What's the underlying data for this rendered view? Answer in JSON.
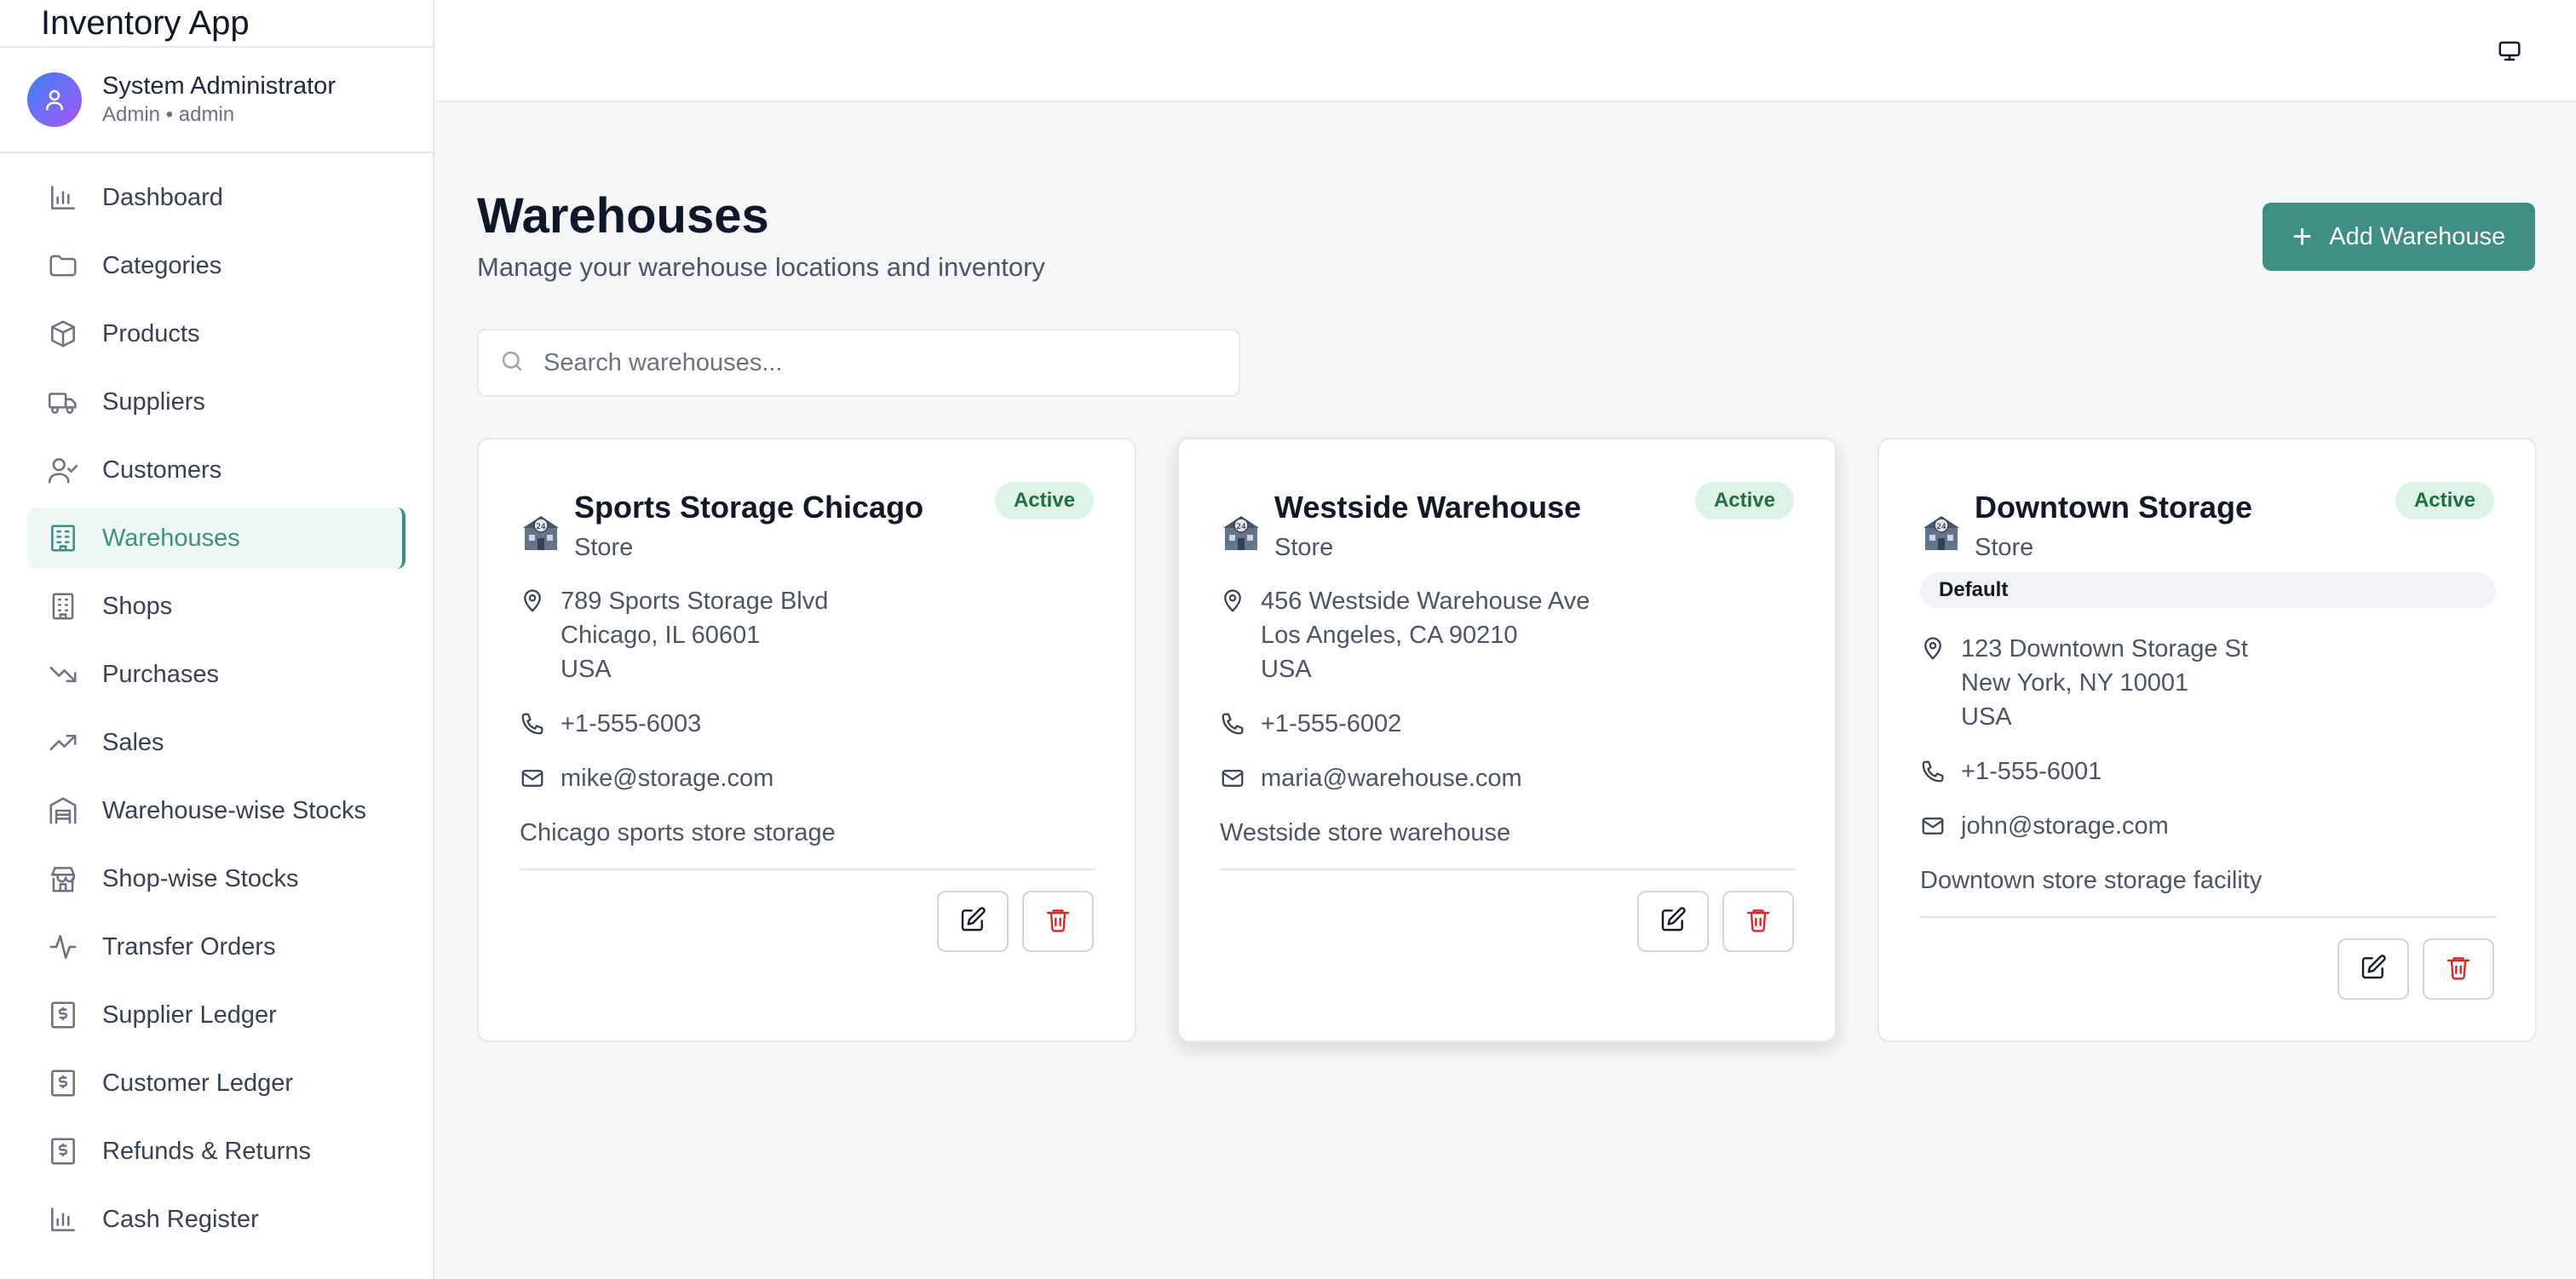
{
  "app": {
    "title": "Inventory App"
  },
  "user": {
    "name": "System Administrator",
    "role_line": "Admin • admin"
  },
  "sidebar": {
    "items": [
      {
        "label": "Dashboard",
        "icon": "bar-chart-icon"
      },
      {
        "label": "Categories",
        "icon": "folder-icon"
      },
      {
        "label": "Products",
        "icon": "box-icon"
      },
      {
        "label": "Suppliers",
        "icon": "truck-icon"
      },
      {
        "label": "Customers",
        "icon": "user-check-icon"
      },
      {
        "label": "Warehouses",
        "icon": "warehouse-building-icon",
        "active": true
      },
      {
        "label": "Shops",
        "icon": "building-icon"
      },
      {
        "label": "Purchases",
        "icon": "trending-down-icon"
      },
      {
        "label": "Sales",
        "icon": "trending-up-icon"
      },
      {
        "label": "Warehouse-wise Stocks",
        "icon": "warehouse-icon"
      },
      {
        "label": "Shop-wise Stocks",
        "icon": "store-icon"
      },
      {
        "label": "Transfer Orders",
        "icon": "activity-icon"
      },
      {
        "label": "Supplier Ledger",
        "icon": "dollar-receipt-icon"
      },
      {
        "label": "Customer Ledger",
        "icon": "dollar-receipt-icon"
      },
      {
        "label": "Refunds & Returns",
        "icon": "dollar-receipt-icon"
      },
      {
        "label": "Cash Register",
        "icon": "bar-chart-icon"
      }
    ]
  },
  "page": {
    "title": "Warehouses",
    "subtitle": "Manage your warehouse locations and inventory",
    "add_button": "Add Warehouse",
    "search_placeholder": "Search warehouses..."
  },
  "colors": {
    "accent": "#3d8f83",
    "active_badge_bg": "#dcf3e5",
    "active_badge_text": "#1f6f43",
    "delete": "#dc2626"
  },
  "warehouses": [
    {
      "name": "Sports Storage Chicago",
      "type": "Store",
      "status": "Active",
      "address": [
        "789 Sports Storage Blvd",
        "Chicago, IL 60601",
        "USA"
      ],
      "phone": "+1-555-6003",
      "email": "mike@storage.com",
      "description": "Chicago sports store storage"
    },
    {
      "name": "Westside Warehouse",
      "type": "Store",
      "status": "Active",
      "address": [
        "456 Westside Warehouse Ave",
        "Los Angeles, CA 90210",
        "USA"
      ],
      "phone": "+1-555-6002",
      "email": "maria@warehouse.com",
      "description": "Westside store warehouse"
    },
    {
      "name": "Downtown Storage",
      "type": "Store",
      "status": "Active",
      "default_label": "Default",
      "address": [
        "123 Downtown Storage St",
        "New York, NY 10001",
        "USA"
      ],
      "phone": "+1-555-6001",
      "email": "john@storage.com",
      "description": "Downtown store storage facility"
    }
  ]
}
